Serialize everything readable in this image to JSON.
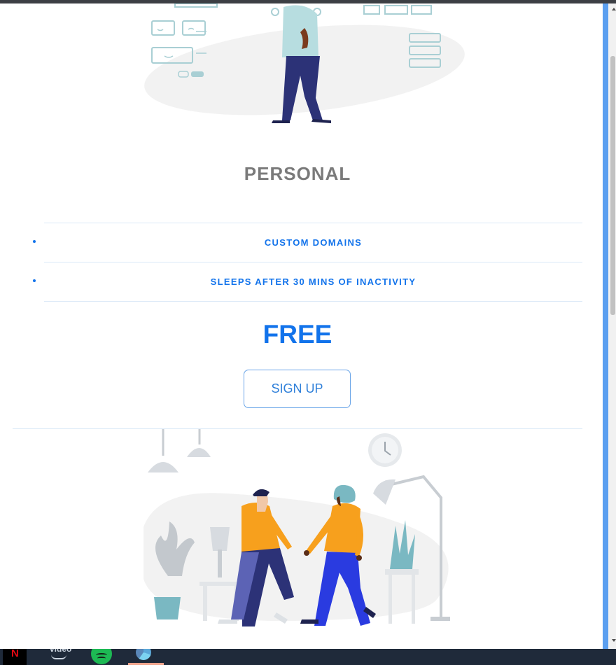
{
  "plan": {
    "title": "PERSONAL",
    "features": [
      "CUSTOM DOMAINS",
      "SLEEPS AFTER 30 MINS OF INACTIVITY"
    ],
    "price": "FREE",
    "signup_label": "SIGN UP"
  },
  "colors": {
    "accent": "#1273eb",
    "title_gray": "#7a7a7a",
    "divider": "#dbe9f7",
    "orange": "#f7a01d",
    "navy": "#2c3277",
    "teal": "#7ab8c2"
  },
  "taskbar": {
    "apps": [
      {
        "name": "netflix-icon",
        "label": "N"
      },
      {
        "name": "prime-video-icon",
        "label": "video"
      },
      {
        "name": "spotify-icon"
      },
      {
        "name": "app-icon"
      }
    ]
  }
}
